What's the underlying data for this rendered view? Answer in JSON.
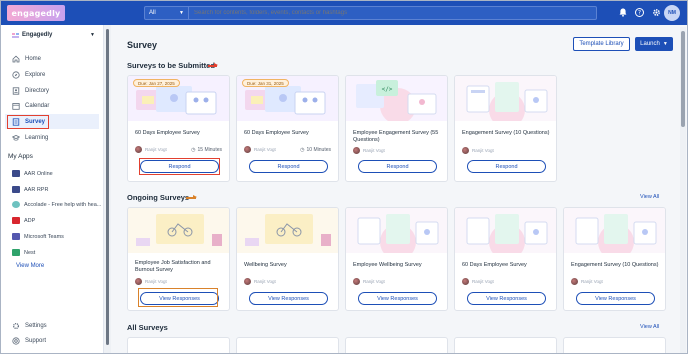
{
  "header": {
    "logo_text": "engagedly",
    "search_scope": "All",
    "search_placeholder": "Search for contents, folders, events, contacts or hashtags",
    "user_initials": "NM"
  },
  "sidebar": {
    "org_name": "Engagedly",
    "nav": [
      {
        "label": "Home"
      },
      {
        "label": "Explore"
      },
      {
        "label": "Directory"
      },
      {
        "label": "Calendar"
      },
      {
        "label": "Survey"
      },
      {
        "label": "Learning"
      }
    ],
    "my_apps_label": "My Apps",
    "apps": [
      {
        "label": "AAR Online"
      },
      {
        "label": "AAR RPR"
      },
      {
        "label": "Accolade - Free help with hea..."
      },
      {
        "label": "ADP"
      },
      {
        "label": "Microsoft Teams"
      },
      {
        "label": "Nest"
      }
    ],
    "view_more": "View More",
    "settings": "Settings",
    "support": "Support"
  },
  "page": {
    "title": "Survey",
    "template_library": "Template Library",
    "launch": "Launch"
  },
  "to_submit": {
    "title": "Surveys to be Submitted",
    "cards": [
      {
        "due": "Due: Jan 27, 2025",
        "title": "60 Days Employee Survey",
        "author": "Ranjit Vogt",
        "duration": "15 Minutes",
        "action": "Respond"
      },
      {
        "due": "Due: Jan 31, 2025",
        "title": "60 Days Employee Survey",
        "author": "Ranjit Vogt",
        "duration": "10 Minutes",
        "action": "Respond"
      },
      {
        "title": "Employee Engagement Survey (55 Questions)",
        "author": "Ranjit Vogt",
        "action": "Respond"
      },
      {
        "title": "Engagement Survey (10 Questions)",
        "author": "Ranjit Vogt",
        "action": "Respond"
      }
    ]
  },
  "ongoing": {
    "title": "Ongoing Surveys",
    "view_all": "View All",
    "cards": [
      {
        "title": "Employee Job Satisfaction and Burnout Survey",
        "author": "Ranjit Vogt",
        "action": "View Responses"
      },
      {
        "title": "Wellbeing Survey",
        "author": "Ranjit Vogt",
        "action": "View Responses"
      },
      {
        "title": "Employee Wellbeing Survey",
        "author": "Ranjit Vogt",
        "action": "View Responses"
      },
      {
        "title": "60 Days Employee Survey",
        "author": "Ranjit Vogt",
        "action": "View Responses"
      },
      {
        "title": "Engagement Survey (10 Questions)",
        "author": "Ranjit Vogt",
        "action": "View Responses"
      }
    ]
  },
  "all_surveys": {
    "title": "All Surveys",
    "view_all": "View All"
  },
  "colors": {
    "brand": "#1d4fb7",
    "highlight": "#e2402f",
    "highlight_orange": "#d9822b"
  }
}
